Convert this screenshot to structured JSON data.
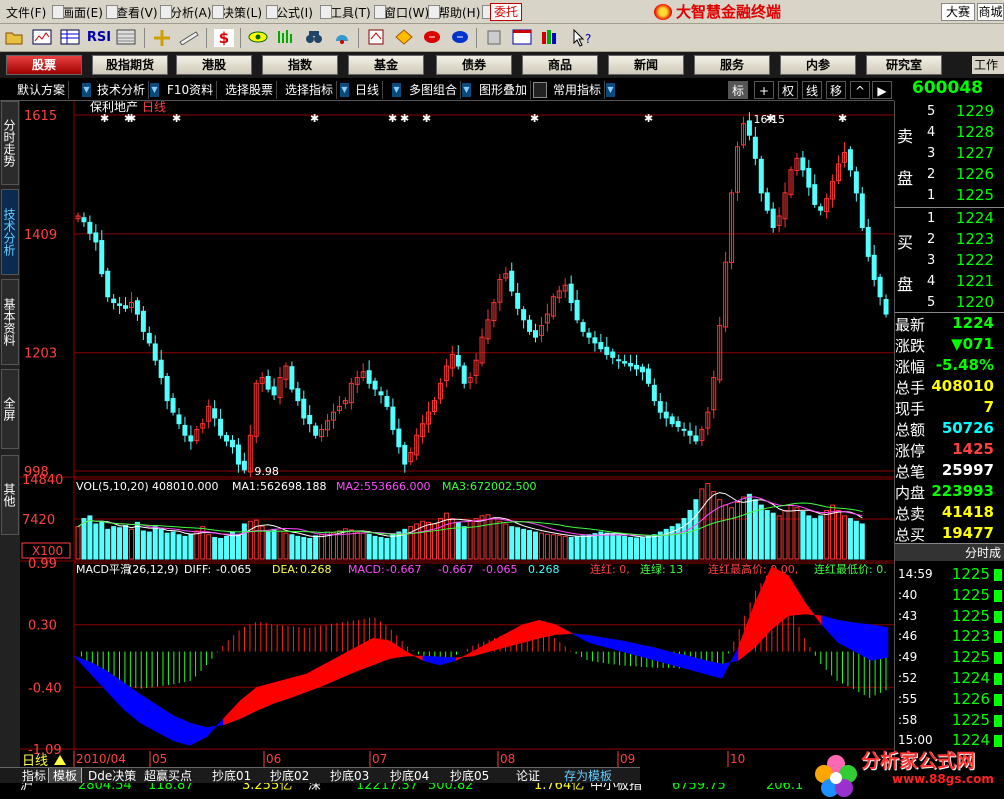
{
  "menubar": {
    "items": [
      "文件(F)",
      "画面(E)",
      "查看(V)",
      "分析(A)",
      "决策(L)",
      "公式(I)",
      "工具(T)",
      "窗口(W)",
      "帮助(H)"
    ],
    "trade_button": "委托",
    "brand_title": "大智慧金融终端",
    "dasai_button": "大赛",
    "mall_button": "商城"
  },
  "toolbar": {
    "rsi_label": "RSI",
    "rights_icon": "$"
  },
  "navbar": {
    "items": [
      "股票",
      "股指期货",
      "港股",
      "指数",
      "基金",
      "债券",
      "商品",
      "新闻",
      "服务",
      "内参",
      "研究室"
    ],
    "active_index": 0,
    "work_label": "工作"
  },
  "chart_toolbar": {
    "items": [
      "默认方案",
      "技术分析",
      "F10资料",
      "选择股票",
      "选择指标",
      "日线",
      "多图组合",
      "图形叠加",
      "常用指标"
    ],
    "right_buttons": [
      "标",
      "+",
      "权",
      "线",
      "移",
      "^",
      "▶"
    ],
    "stock_code": "600048",
    "stock_code_suffix": "保"
  },
  "left_tabs": [
    "分时走势",
    "技术分析",
    "基本资料",
    "全屏",
    "其他"
  ],
  "left_tabs_active": 1,
  "price_chart": {
    "stock_name": "保利地产",
    "period": "日线",
    "y_ticks": [
      "1615",
      "1409",
      "1203",
      "998"
    ],
    "high_label": "16.15",
    "low_label": "9.98"
  },
  "volume_chart": {
    "header": "VOL(5,10,20)",
    "vol": "408010.000",
    "ma1_label": "MA1:",
    "ma1": "562698.188",
    "ma2_label": "MA2:",
    "ma2": "553666.000",
    "ma3_label": "MA3:",
    "ma3": "672002.500",
    "y_ticks": [
      "14840",
      "7420"
    ],
    "unit": "X100"
  },
  "macd_chart": {
    "header": "MACD平滑",
    "params": "(26,12,9)",
    "diff_label": "DIFF:",
    "diff": "-0.065",
    "dea_label": "DEA:",
    "dea": "0.268",
    "macd_label": "MACD:",
    "macd": "-0.667",
    "v4": "-0.667",
    "v5": "-0.065",
    "v6": "0.268",
    "lianhong": "连红: 0,",
    "lianlu": "连绿: 13",
    "lhmax": "连红最高价: 0.00,",
    "lhmin": "连红最低价: 0.",
    "y_ticks": [
      "0.99",
      "0.30",
      "-0.40",
      "-1.09"
    ]
  },
  "x_axis": {
    "labels": [
      "2010/04",
      "05",
      "06",
      "07",
      "08",
      "09",
      "10"
    ],
    "period_label": "日线"
  },
  "order_book": {
    "sell_label": [
      "卖",
      "盘"
    ],
    "buy_label": [
      "买",
      "盘"
    ],
    "sells": [
      {
        "level": "5",
        "price": "1229"
      },
      {
        "level": "4",
        "price": "1228"
      },
      {
        "level": "3",
        "price": "1227"
      },
      {
        "level": "2",
        "price": "1226"
      },
      {
        "level": "1",
        "price": "1225"
      }
    ],
    "buys": [
      {
        "level": "1",
        "price": "1224"
      },
      {
        "level": "2",
        "price": "1223"
      },
      {
        "level": "3",
        "price": "1222"
      },
      {
        "level": "4",
        "price": "1221"
      },
      {
        "level": "5",
        "price": "1220"
      }
    ]
  },
  "stats": [
    {
      "label": "最新",
      "value": "1224",
      "color": "#00ff00"
    },
    {
      "label": "涨跌",
      "value": "▼071",
      "color": "#00ff00"
    },
    {
      "label": "涨幅",
      "value": "-5.48%",
      "color": "#00ff00"
    },
    {
      "label": "总手",
      "value": "408010",
      "color": "#ffff00"
    },
    {
      "label": "现手",
      "value": "7",
      "color": "#ffff00"
    },
    {
      "label": "总额",
      "value": "50726",
      "color": "#00ffff"
    },
    {
      "label": "涨停",
      "value": "1425",
      "color": "#ff4040"
    },
    {
      "label": "总笔",
      "value": "25997",
      "color": "#ffffff"
    },
    {
      "label": "内盘",
      "value": "223993",
      "color": "#00ff00"
    },
    {
      "label": "总卖",
      "value": "41418",
      "color": "#ffff00"
    },
    {
      "label": "总买",
      "value": "19477",
      "color": "#ffff00"
    }
  ],
  "timesales": {
    "title": "分时成",
    "rows": [
      {
        "time": "14:59",
        "price": "1225"
      },
      {
        "time": ":40",
        "price": "1225"
      },
      {
        "time": ":43",
        "price": "1225"
      },
      {
        "time": ":46",
        "price": "1223"
      },
      {
        "time": ":49",
        "price": "1225"
      },
      {
        "time": ":52",
        "price": "1224"
      },
      {
        "time": ":55",
        "price": "1226"
      },
      {
        "time": ":58",
        "price": "1225"
      },
      {
        "time": "15:00",
        "price": "1224"
      }
    ]
  },
  "bottom_tabs": [
    "指标",
    "模板",
    "Dde决策",
    "超赢买点",
    "抄底01",
    "抄底02",
    "抄底03",
    "抄底04",
    "抄底05",
    "论证",
    "存为模板"
  ],
  "bottom_tabs_active": 1,
  "ticker": [
    {
      "text": "沪",
      "color": "#ffffff"
    },
    {
      "text": "2804.54",
      "color": "#00ff00"
    },
    {
      "text": "118.87",
      "color": "#00ff00"
    },
    {
      "text": "3.255亿",
      "color": "#ffff00"
    },
    {
      "text": "深",
      "color": "#ffffff"
    },
    {
      "text": "12217.37",
      "color": "#00ff00"
    },
    {
      "text": "500.82",
      "color": "#00ff00"
    },
    {
      "text": "1.764亿",
      "color": "#ffff00"
    },
    {
      "text": "中小板指",
      "color": "#ffffff"
    },
    {
      "text": "6759.75",
      "color": "#00ff00"
    },
    {
      "text": "206.1",
      "color": "#00ff00"
    }
  ],
  "watermark": {
    "title": "分析家公式网",
    "url": "www.88gs.com"
  },
  "colors": {
    "up": "#ff3232",
    "down": "#54ffff",
    "gridline": "#8b0000",
    "macd_pos": "#ff2020",
    "macd_neg": "#20ff20",
    "fill_up": "#ff0000",
    "fill_down": "#0000ff"
  },
  "chart_data": [
    {
      "type": "candlestick",
      "title": "保利地产 日线",
      "ylim": [
        998,
        1615
      ],
      "x_range": [
        "2010/04",
        "10"
      ],
      "high": 1615,
      "low": 998,
      "close_path": [
        1440,
        1430,
        1410,
        1395,
        1340,
        1300,
        1290,
        1285,
        1280,
        1290,
        1270,
        1240,
        1220,
        1190,
        1160,
        1120,
        1100,
        1080,
        1060,
        1050,
        1070,
        1080,
        1110,
        1090,
        1060,
        1050,
        1040,
        1010,
        1000,
        1060,
        1150,
        1160,
        1140,
        1130,
        1160,
        1180,
        1140,
        1120,
        1090,
        1080,
        1060,
        1070,
        1085,
        1100,
        1110,
        1120,
        1150,
        1160,
        1170,
        1150,
        1140,
        1130,
        1110,
        1070,
        1040,
        1010,
        1030,
        1060,
        1080,
        1100,
        1120,
        1150,
        1180,
        1200,
        1180,
        1150,
        1160,
        1190,
        1230,
        1260,
        1290,
        1330,
        1340,
        1310,
        1280,
        1260,
        1240,
        1230,
        1250,
        1270,
        1300,
        1310,
        1320,
        1290,
        1260,
        1240,
        1230,
        1220,
        1210,
        1200,
        1195,
        1190,
        1185,
        1180,
        1175,
        1170,
        1150,
        1120,
        1100,
        1090,
        1080,
        1075,
        1070,
        1060,
        1050,
        1070,
        1100,
        1160,
        1250,
        1360,
        1480,
        1560,
        1600,
        1580,
        1540,
        1480,
        1450,
        1420,
        1440,
        1480,
        1520,
        1540,
        1520,
        1490,
        1460,
        1450,
        1470,
        1500,
        1530,
        1550,
        1520,
        1480,
        1420,
        1370,
        1330,
        1300,
        1270
      ]
    },
    {
      "type": "bar",
      "title": "VOL(5,10,20)",
      "ylim": [
        0,
        14840
      ],
      "series": [
        {
          "name": "VOL",
          "values": [
            6000,
            7500,
            8000,
            6500,
            7000,
            5500,
            6000,
            5800,
            6200,
            5500,
            6800,
            5200,
            5000,
            6000,
            5500,
            4800,
            5000,
            4500,
            4200,
            4600,
            5200,
            6000,
            4500,
            4000,
            3800,
            4200,
            5000,
            4500,
            6500,
            7000,
            7200,
            6000,
            5000,
            5500,
            5200,
            4800,
            4500,
            4200,
            4000,
            3800,
            4300,
            4500,
            5000,
            4800,
            5200,
            5600,
            5400,
            5000,
            4800,
            4600,
            4200,
            4000,
            3800,
            4500,
            5000,
            5500,
            6000,
            6500,
            7000,
            6800,
            6500,
            7500,
            8500,
            7500,
            6800,
            6000,
            7000,
            7500,
            8000,
            8200,
            7600,
            7000,
            6500,
            6000,
            5800,
            5500,
            5300,
            5000,
            4800,
            4600,
            4500,
            4400,
            4200,
            4000,
            4100,
            4300,
            4500,
            4700,
            5000,
            4800,
            4600,
            4400,
            4200,
            4000,
            3900,
            4000,
            4200,
            4500,
            5000,
            5500,
            6000,
            6500,
            7500,
            9000,
            11000,
            13000,
            14000,
            12500,
            11000,
            10000,
            9500,
            10500,
            11500,
            12000,
            11000,
            10000,
            9000,
            8500,
            8000,
            9000,
            10000,
            9500,
            8800,
            8000,
            7500,
            8000,
            9000,
            10000,
            9000,
            8000,
            7500,
            7000,
            6500
          ]
        }
      ]
    },
    {
      "type": "line",
      "title": "MACD平滑 (26,12,9)",
      "ylim": [
        -1.09,
        0.99
      ],
      "series": [
        {
          "name": "DIFF",
          "values": [
            -0.05,
            -0.25,
            -0.45,
            -0.65,
            -0.8,
            -0.9,
            -1.0,
            -1.05,
            -0.95,
            -0.75,
            -0.55,
            -0.4,
            -0.35,
            -0.3,
            -0.25,
            -0.15,
            -0.05,
            0.05,
            0.15,
            0.12,
            0.0,
            -0.1,
            -0.15,
            -0.1,
            0.0,
            0.1,
            0.2,
            0.3,
            0.35,
            0.3,
            0.2,
            0.1,
            0.05,
            0.0,
            -0.05,
            -0.1,
            -0.15,
            -0.2,
            -0.25,
            -0.3,
            0.05,
            0.55,
            0.95,
            0.85,
            0.55,
            0.3,
            0.1,
            0.0,
            -0.1,
            -0.065
          ]
        },
        {
          "name": "DEA",
          "values": [
            -0.05,
            -0.12,
            -0.22,
            -0.35,
            -0.48,
            -0.6,
            -0.72,
            -0.8,
            -0.85,
            -0.82,
            -0.75,
            -0.66,
            -0.58,
            -0.52,
            -0.45,
            -0.38,
            -0.3,
            -0.22,
            -0.15,
            -0.08,
            -0.05,
            -0.05,
            -0.06,
            -0.07,
            -0.05,
            0.0,
            0.05,
            0.1,
            0.15,
            0.19,
            0.2,
            0.18,
            0.15,
            0.12,
            0.08,
            0.04,
            -0.01,
            -0.05,
            -0.1,
            -0.14,
            -0.1,
            0.05,
            0.25,
            0.4,
            0.42,
            0.4,
            0.35,
            0.32,
            0.3,
            0.268
          ]
        }
      ]
    }
  ]
}
